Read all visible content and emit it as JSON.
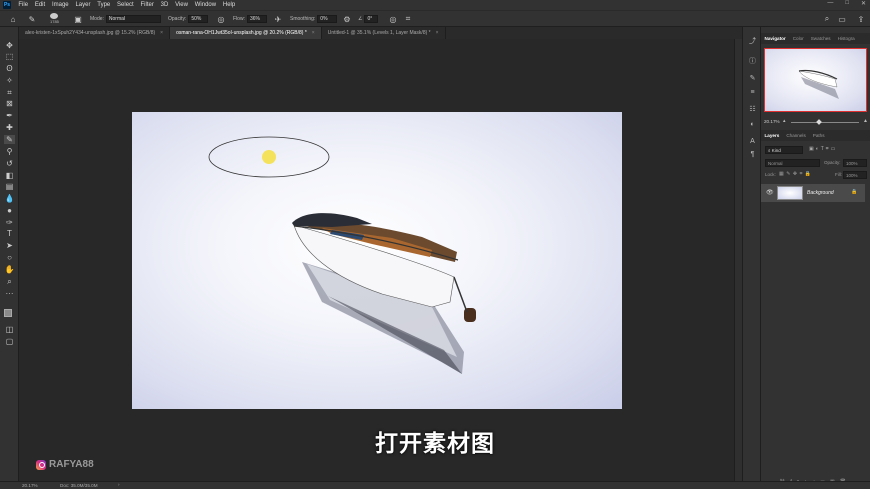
{
  "app": {
    "logo": "Ps"
  },
  "menu": [
    "File",
    "Edit",
    "Image",
    "Layer",
    "Type",
    "Select",
    "Filter",
    "3D",
    "View",
    "Window",
    "Help"
  ],
  "window_controls": [
    "—",
    "□",
    "✕"
  ],
  "options": {
    "brush_size": "1785",
    "mode_label": "Mode:",
    "mode_value": "Normal",
    "opacity_label": "Opacity:",
    "opacity_value": "50%",
    "flow_label": "Flow:",
    "flow_value": "36%",
    "smoothing_label": "Smoothing:",
    "smoothing_value": "0%",
    "angle_value": "0°"
  },
  "tabs": [
    {
      "label": "alex-kristen-1xSpuh2Y434-unsplash.jpg @ 15.2% (RGB/8)",
      "close": "×"
    },
    {
      "label": "osman-rana-OH1Jwt35oI-unsplash.jpg @ 20.2% (RGB/8) *",
      "close": "×"
    },
    {
      "label": "Untitled-1 @ 35.1% (Levels 1, Layer Mask/8) *",
      "close": "×"
    }
  ],
  "navigator": {
    "tabs": [
      "Navigator",
      "Color",
      "Swatches",
      "Histogra"
    ],
    "zoom": "20.17%"
  },
  "layers_panel": {
    "tabs": [
      "Layers",
      "Channels",
      "Paths"
    ],
    "filter_kind": "Kind",
    "blend_mode": "Normal",
    "opacity_label": "Opacity:",
    "opacity_value": "100%",
    "lock_label": "Lock:",
    "fill_label": "Fill:",
    "fill_value": "100%",
    "layers": [
      {
        "name": "Background"
      }
    ]
  },
  "status": {
    "zoom": "20.17%",
    "doc": "Doc: 35.0M/35.0M"
  },
  "overlay": {
    "subtitle": "打开素材图",
    "watermark": "RAFYA88"
  },
  "colors": {
    "accent": "#31a8ff",
    "selection_highlight": "#e03030",
    "brush_cursor": "#f5e04a"
  }
}
